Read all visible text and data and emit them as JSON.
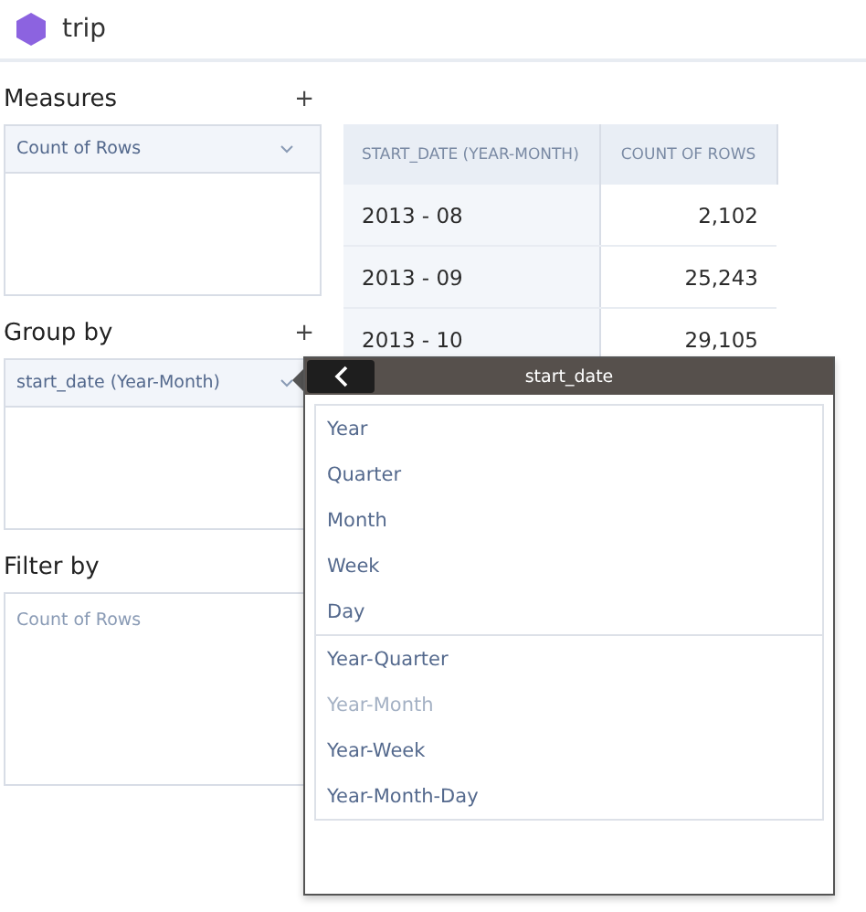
{
  "header": {
    "title": "trip"
  },
  "measures": {
    "title": "Measures",
    "add": "+",
    "items": [
      "Count of Rows"
    ]
  },
  "group_by": {
    "title": "Group by",
    "add": "+",
    "items": [
      "start_date (Year-Month)"
    ]
  },
  "filter_by": {
    "title": "Filter by",
    "placeholder": "Count of Rows"
  },
  "table": {
    "columns": [
      "START_DATE (YEAR-MONTH)",
      "COUNT OF ROWS"
    ],
    "rows": [
      [
        "2013 - 08",
        "2,102"
      ],
      [
        "2013 - 09",
        "25,243"
      ],
      [
        "2013 - 10",
        "29,105"
      ]
    ]
  },
  "popover": {
    "title": "start_date",
    "groups": [
      [
        {
          "label": "Year",
          "disabled": false
        },
        {
          "label": "Quarter",
          "disabled": false
        },
        {
          "label": "Month",
          "disabled": false
        },
        {
          "label": "Week",
          "disabled": false
        },
        {
          "label": "Day",
          "disabled": false
        }
      ],
      [
        {
          "label": "Year-Quarter",
          "disabled": false
        },
        {
          "label": "Year-Month",
          "disabled": true
        },
        {
          "label": "Year-Week",
          "disabled": false
        },
        {
          "label": "Year-Month-Day",
          "disabled": false
        }
      ]
    ]
  }
}
